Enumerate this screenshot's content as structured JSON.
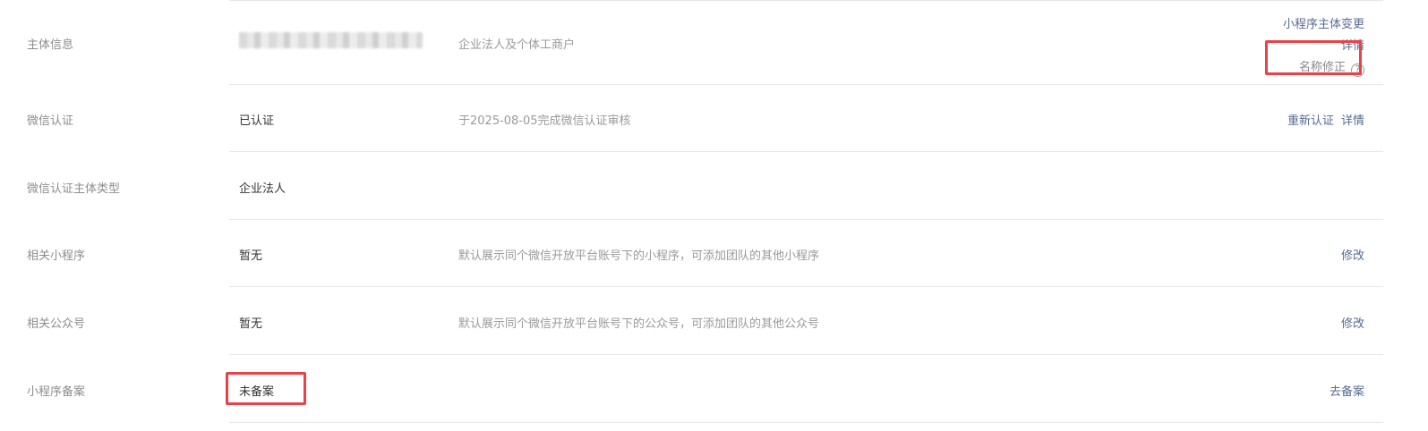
{
  "rows": [
    {
      "label": "主体信息",
      "value": "",
      "desc": "企业法人及个体工商户",
      "actions": {
        "change": "小程序主体变更",
        "details": "详情",
        "name_fix": "名称修正",
        "help_icon": "question-circle-icon"
      }
    },
    {
      "label": "微信认证",
      "value": "已认证",
      "desc": "于2025-08-05完成微信认证审核",
      "actions": {
        "reauth": "重新认证",
        "details": "详情"
      }
    },
    {
      "label": "微信认证主体类型",
      "value": "企业法人",
      "desc": ""
    },
    {
      "label": "相关小程序",
      "value": "暂无",
      "desc": "默认展示同个微信开放平台账号下的小程序，可添加团队的其他小程序",
      "actions": {
        "modify": "修改"
      }
    },
    {
      "label": "相关公众号",
      "value": "暂无",
      "desc": "默认展示同个微信开放平台账号下的公众号，可添加团队的其他公众号",
      "actions": {
        "modify": "修改"
      }
    },
    {
      "label": "小程序备案",
      "value": "未备案",
      "desc": "",
      "actions": {
        "filing": "去备案"
      }
    }
  ],
  "colors": {
    "link": "#576b95",
    "highlight": "#e8434a",
    "divider": "#e7e7eb"
  }
}
